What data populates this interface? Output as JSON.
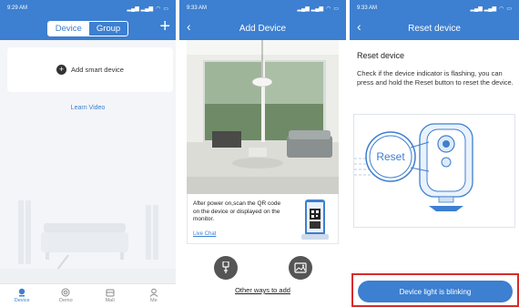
{
  "phone1": {
    "status": {
      "time": "9:29 AM",
      "signals": "⁵⁶ᴵˡ ⁵⁶ᴵˡ",
      "battery": "▭"
    },
    "segment": {
      "device_label": "Device",
      "group_label": "Group"
    },
    "add_icon": "plus-icon",
    "add_smart_device_label": "Add smart device",
    "learn_video_label": "Learn Video",
    "tabs": [
      {
        "label": "Device",
        "icon": "device-icon"
      },
      {
        "label": "Demo",
        "icon": "demo-icon"
      },
      {
        "label": "Mall",
        "icon": "mall-icon"
      },
      {
        "label": "Me",
        "icon": "me-icon"
      }
    ]
  },
  "phone2": {
    "status": {
      "time": "9:33 AM"
    },
    "title": "Add Device",
    "info_text": "After power on,scan the QR code on the device or displayed on the monitor.",
    "live_chat_label": "Live Chat",
    "other_ways_label": "Other ways to add"
  },
  "phone3": {
    "status": {
      "time": "9:33 AM"
    },
    "title": "Reset device",
    "heading": "Reset device",
    "description": "Check if the device indicator is flashing, you can press and hold the Reset button to reset the device.",
    "reset_label": "Reset",
    "button_label": "Device light is blinking",
    "highlight_color": "#d82b2b"
  },
  "colors": {
    "accent": "#3d7fd0"
  }
}
